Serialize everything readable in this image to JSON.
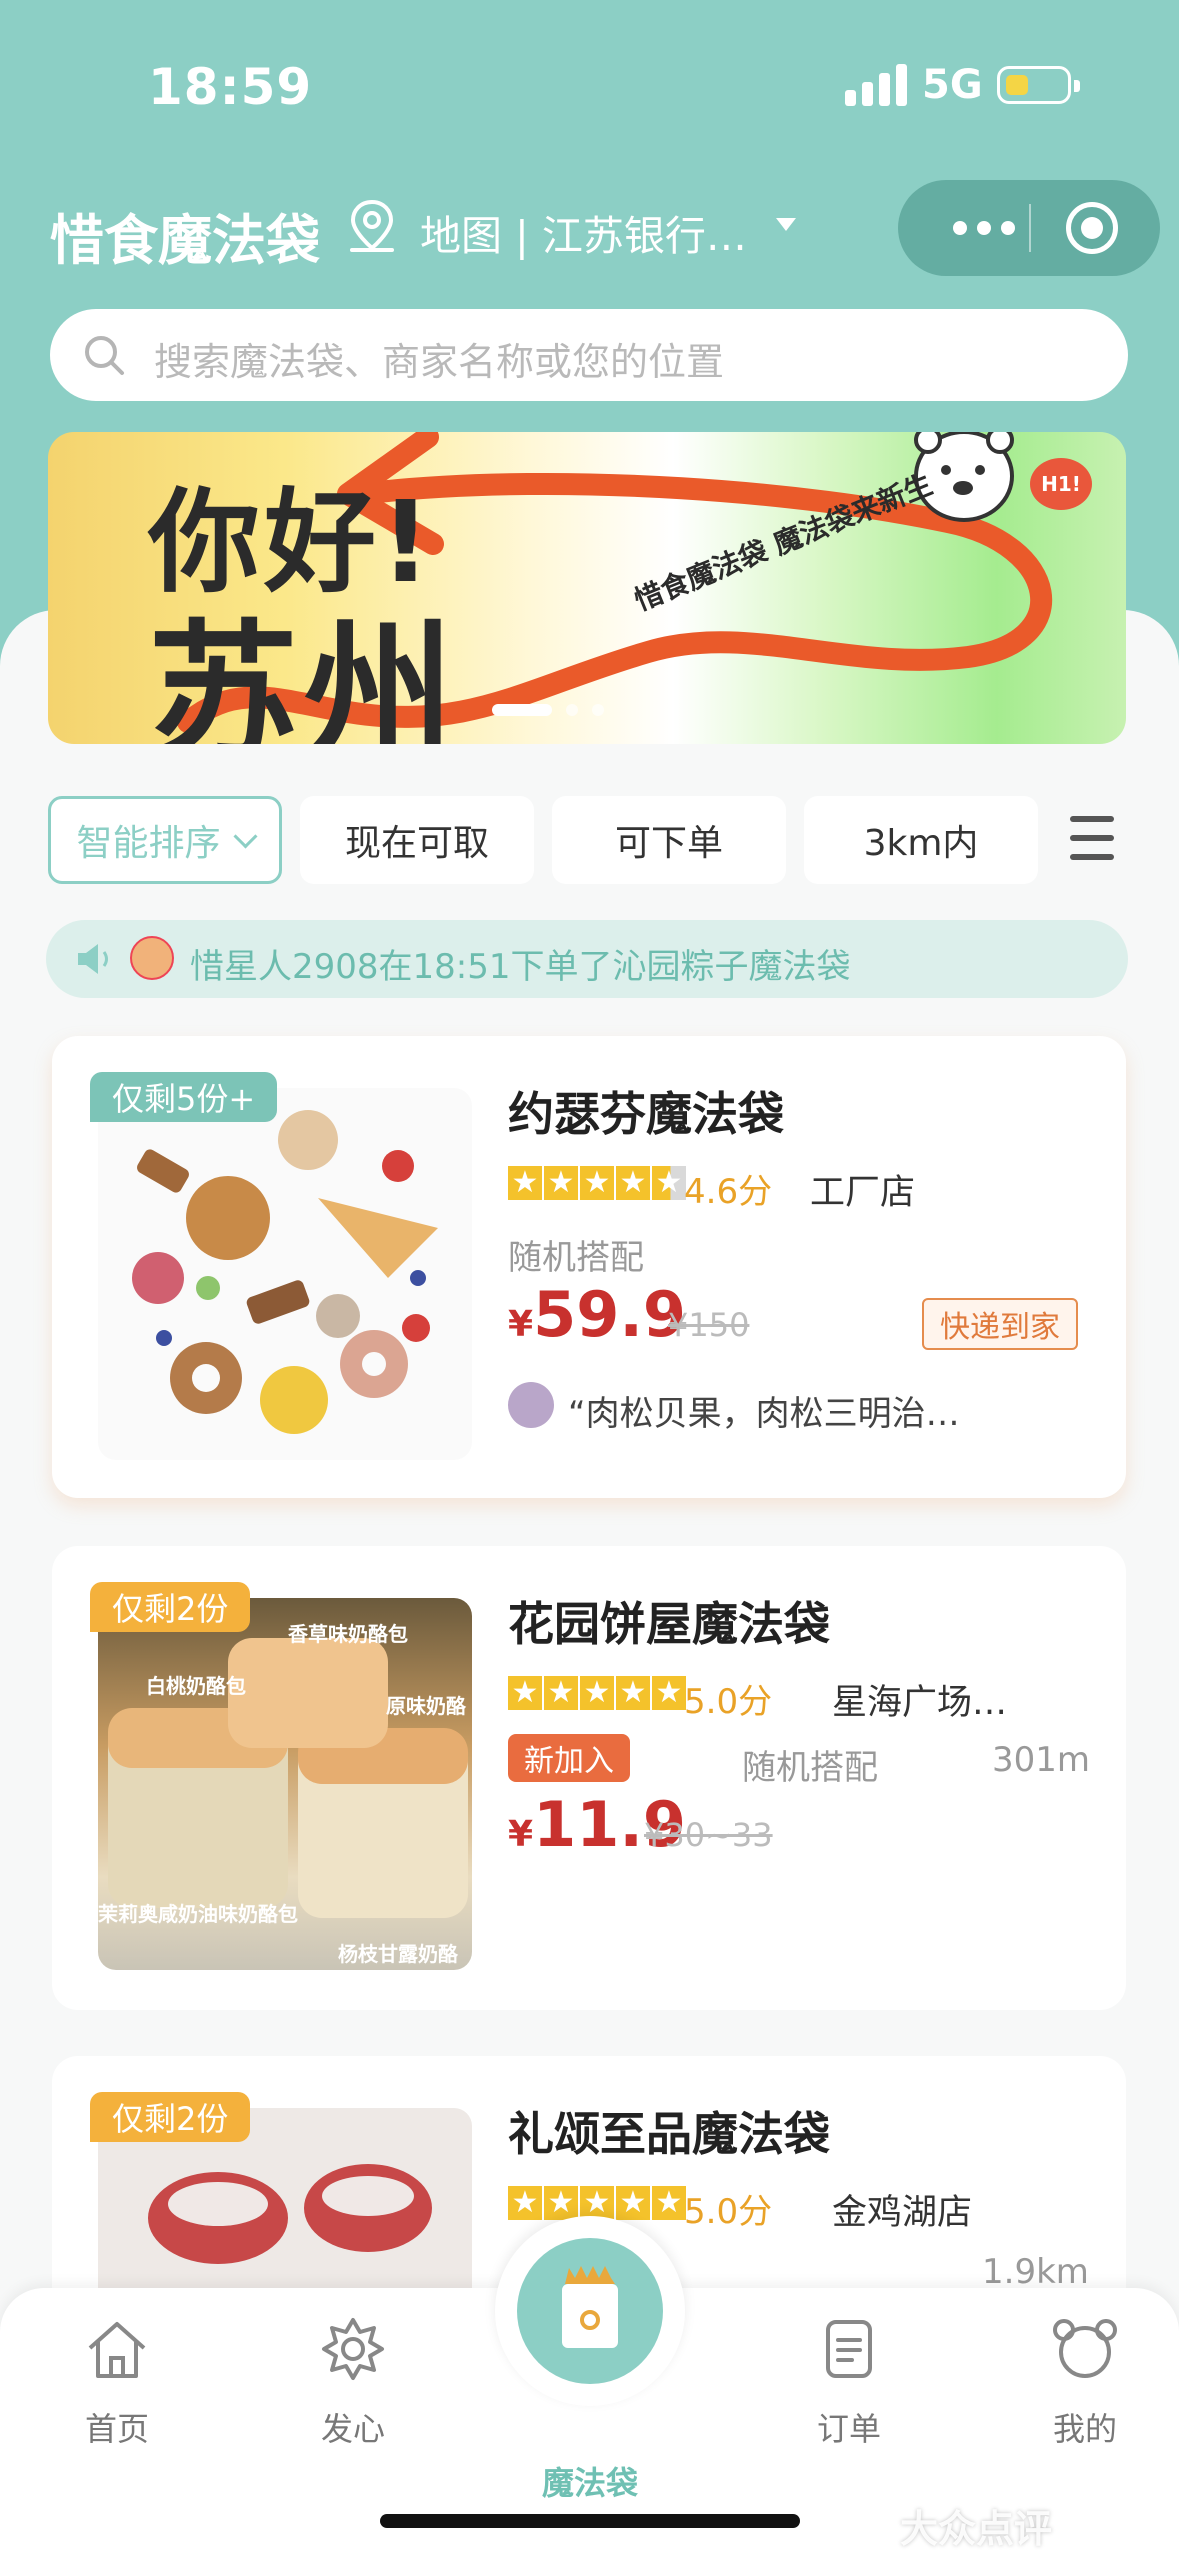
{
  "status_bar": {
    "time": "18:59",
    "network": "5G"
  },
  "header": {
    "app_title": "惜食魔法袋",
    "location_text": "地图 | 江苏银行…",
    "search_placeholder": "搜索魔法袋、商家名称或您的位置"
  },
  "banner": {
    "line1": "你好!",
    "line2": "苏州",
    "slogan": "惜食魔法袋 魔法袋来新生",
    "hi": "H1!"
  },
  "filters": [
    "智能排序",
    "现在可取",
    "可下单",
    "3km内"
  ],
  "notice": "惜星人2908在18:51下单了沁园粽子魔法袋",
  "cards": [
    {
      "tag": "仅剩5份+",
      "title": "约瑟芬魔法袋",
      "score": "4.6分",
      "store": "工厂店",
      "desc": "随机搭配",
      "currency": "¥",
      "price": "59.9",
      "orig_price": "¥150",
      "badge": "快递到家",
      "review": "“肉松贝果，肉松三明治…"
    },
    {
      "tag": "仅剩2份",
      "title": "花园饼屋魔法袋",
      "score": "5.0分",
      "store": "星海广场…",
      "new_badge": "新加入",
      "desc": "随机搭配",
      "distance": "301m",
      "currency": "¥",
      "price": "11.9",
      "orig_price": "¥30~33",
      "photo_labels": [
        "香草味奶酪包",
        "白桃奶酪包",
        "原味奶酪",
        "茉莉奥咸奶油味奶酪包",
        "杨枝甘露奶酪"
      ]
    },
    {
      "tag": "仅剩2份",
      "title": "礼颂至品魔法袋",
      "score": "5.0分",
      "store": "金鸡湖店",
      "distance": "1.9km"
    }
  ],
  "tabbar": [
    "首页",
    "发心",
    "魔法袋",
    "订单",
    "我的"
  ],
  "watermark": "大众点评",
  "colors": {
    "brand_teal": "#8ccfc5",
    "price_red": "#c8312e",
    "score_gold": "#e9a227",
    "tag_orange": "#f4b13c"
  },
  "icons": [
    "location-pin-icon",
    "more-dots-icon",
    "target-icon",
    "search-icon",
    "menu-icon",
    "speaker-icon",
    "home-icon",
    "star-badge-icon",
    "magic-bag-icon",
    "order-icon",
    "bear-profile-icon"
  ]
}
